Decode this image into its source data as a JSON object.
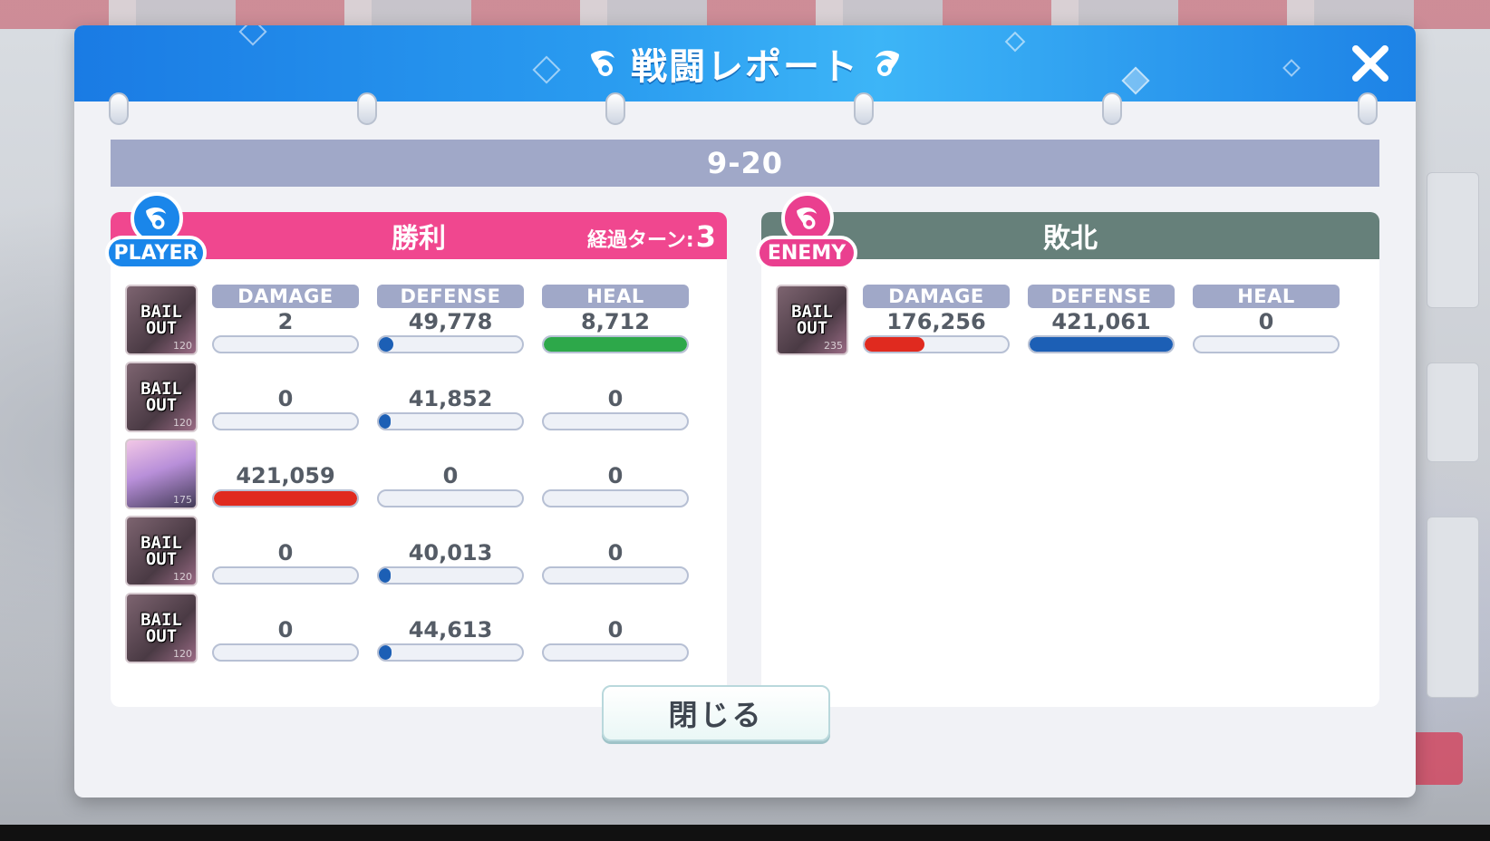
{
  "dialog": {
    "title": "戦闘レポート",
    "stage": "9-20",
    "close_label": "閉じる"
  },
  "player": {
    "badge": "PLAYER",
    "result": "勝利",
    "turns_label": "経過ターン:",
    "turns_value": "3",
    "headers": {
      "damage": "DAMAGE",
      "defense": "DEFENSE",
      "heal": "HEAL"
    },
    "units": [
      {
        "portrait": "BAIL OUT",
        "level": "120",
        "damage": "2",
        "defense": "49,778",
        "heal": "8,712",
        "damage_fill": 0.0,
        "defense_fill": 0.1,
        "heal_fill": 1.0
      },
      {
        "portrait": "BAIL OUT",
        "level": "120",
        "damage": "0",
        "defense": "41,852",
        "heal": "0",
        "damage_fill": 0.0,
        "defense_fill": 0.08,
        "heal_fill": 0.0
      },
      {
        "portrait": "character",
        "level": "175",
        "damage": "421,059",
        "defense": "0",
        "heal": "0",
        "damage_fill": 1.0,
        "defense_fill": 0.0,
        "heal_fill": 0.0
      },
      {
        "portrait": "BAIL OUT",
        "level": "120",
        "damage": "0",
        "defense": "40,013",
        "heal": "0",
        "damage_fill": 0.0,
        "defense_fill": 0.08,
        "heal_fill": 0.0
      },
      {
        "portrait": "BAIL OUT",
        "level": "120",
        "damage": "0",
        "defense": "44,613",
        "heal": "0",
        "damage_fill": 0.0,
        "defense_fill": 0.09,
        "heal_fill": 0.0
      }
    ]
  },
  "enemy": {
    "badge": "ENEMY",
    "result": "敗北",
    "headers": {
      "damage": "DAMAGE",
      "defense": "DEFENSE",
      "heal": "HEAL"
    },
    "units": [
      {
        "portrait": "BAIL OUT",
        "level": "235",
        "damage": "176,256",
        "defense": "421,061",
        "heal": "0",
        "damage_fill": 0.42,
        "defense_fill": 1.0,
        "heal_fill": 0.0
      }
    ]
  },
  "colors": {
    "damage": "#e02a1f",
    "defense": "#1c5fb5",
    "heal": "#2da84a",
    "player_accent": "#f0478f",
    "enemy_accent": "#66807a",
    "header_blue": "#1a86ea"
  },
  "icons": {
    "wing": "wing-icon",
    "close": "close-icon"
  }
}
